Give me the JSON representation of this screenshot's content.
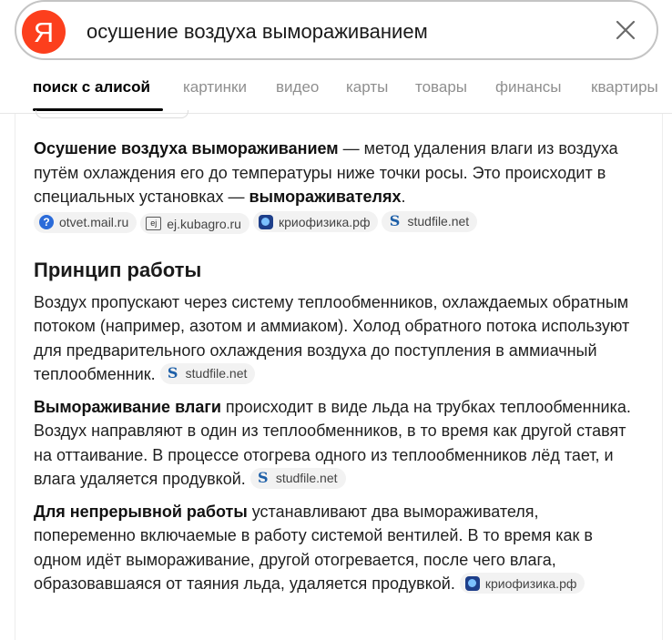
{
  "search": {
    "logo_letter": "Я",
    "query": "осушение воздуха вымораживанием"
  },
  "tabs": [
    {
      "label": "поиск с алисой",
      "active": true
    },
    {
      "label": "картинки",
      "active": false
    },
    {
      "label": "видео",
      "active": false
    },
    {
      "label": "карты",
      "active": false
    },
    {
      "label": "товары",
      "active": false
    },
    {
      "label": "финансы",
      "active": false
    },
    {
      "label": "квартиры",
      "active": false
    }
  ],
  "answer": {
    "intro": {
      "bold1": "Осушение воздуха вымораживанием",
      "text1": " — метод удаления влаги из воздуха путём охлаждения его до температуры ниже точки росы. Это происходит в специальных установках — ",
      "bold2": "вымораживателях",
      "text2": ".",
      "sources": [
        "otvet.mail.ru",
        "ej.kubagro.ru",
        "криофизика.рф",
        "studfile.net"
      ]
    },
    "section_title": "Принцип работы",
    "para1": {
      "text": "Воздух пропускают через систему теплообменников, охлаждаемых обратным потоком (например, азотом и аммиаком). Холод обратного потока используют для предварительного охлаждения воздуха до поступления в аммиачный теплообменник.",
      "source": "studfile.net"
    },
    "para2": {
      "bold": "Вымораживание влаги",
      "text": " происходит в виде льда на трубках теплообменника. Воздух направляют в один из теплообменников, в то время как другой ставят на оттаивание. В процессе отогрева одного из теплообменников лёд тает, и влага удаляется продувкой.",
      "source": "studfile.net"
    },
    "para3": {
      "bold": "Для непрерывной работы",
      "text": " устанавливают два вымораживателя, попеременно включаемые в работу системой вентилей. В то время как в одном идёт вымораживание, другой отогревается, после чего влага, образовавшаяся от таяния льда, удаляется продувкой.",
      "source": "криофизика.рф"
    }
  },
  "icons": {
    "logo": "yandex-logo",
    "clear": "close-icon",
    "source_favicons": [
      "mail-favicon",
      "ej-favicon",
      "kriofizika-favicon",
      "studfile-favicon"
    ]
  },
  "colors": {
    "brand": "#fc3f1d",
    "active_tab": "#000000",
    "inactive_tab": "#8f8f8f",
    "source_pill": "#f2f2f2"
  }
}
